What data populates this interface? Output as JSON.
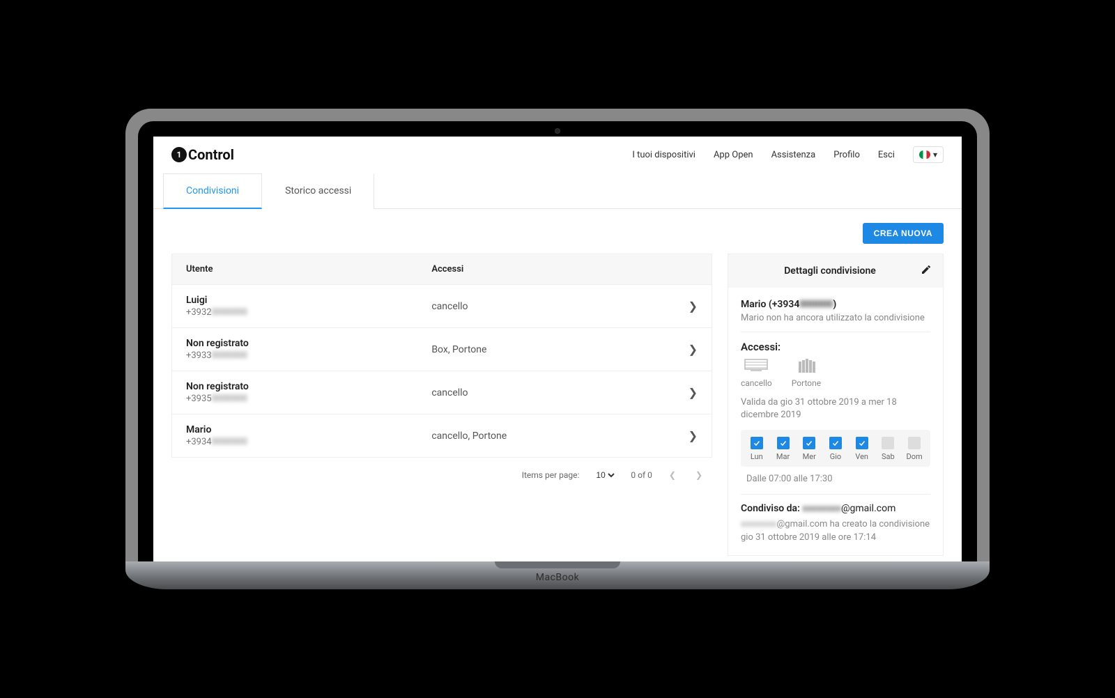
{
  "brand": "Control",
  "nav": {
    "devices": "I tuoi dispositivi",
    "appopen": "App Open",
    "assist": "Assistenza",
    "profile": "Profilo",
    "logout": "Esci"
  },
  "tabs": {
    "shares": "Condivisioni",
    "history": "Storico accessi"
  },
  "toolbar": {
    "create": "CREA NUOVA"
  },
  "table": {
    "head_user": "Utente",
    "head_access": "Accessi",
    "rows": [
      {
        "name": "Luigi",
        "phone_prefix": "+3932",
        "phone_hidden": "0000000",
        "access": "cancello"
      },
      {
        "name": "Non registrato",
        "phone_prefix": "+3933",
        "phone_hidden": "0000000",
        "access": "Box, Portone"
      },
      {
        "name": "Non registrato",
        "phone_prefix": "+3935",
        "phone_hidden": "0000000",
        "access": "cancello"
      },
      {
        "name": "Mario",
        "phone_prefix": "+3934",
        "phone_hidden": "0000000",
        "access": "cancello, Portone"
      }
    ]
  },
  "paginator": {
    "label": "Items per page:",
    "size": "10",
    "range": "0 of 0"
  },
  "details": {
    "title": "Dettagli condivisione",
    "name_prefix": "Mario (+3934",
    "name_hidden": "000000",
    "name_suffix": ")",
    "note": "Mario non ha ancora utilizzato la condivisione",
    "accessi_label": "Accessi:",
    "accesses": [
      {
        "label": "cancello"
      },
      {
        "label": "Portone"
      }
    ],
    "validity": "Valida da gio 31 ottobre 2019 a mer 18 dicembre 2019",
    "days": [
      {
        "label": "Lun",
        "on": true
      },
      {
        "label": "Mar",
        "on": true
      },
      {
        "label": "Mer",
        "on": true
      },
      {
        "label": "Gio",
        "on": true
      },
      {
        "label": "Ven",
        "on": true
      },
      {
        "label": "Sab",
        "on": false
      },
      {
        "label": "Dom",
        "on": false
      }
    ],
    "hours": "Dalle 07:00 alle 17:30",
    "shared_label": "Condiviso da: ",
    "shared_email_hidden": "xxxxxxxx",
    "shared_email_suffix": "@gmail.com",
    "shared_note_hidden": "xxxxxxxx",
    "shared_note_text": "@gmail.com ha creato la condivisione gio 31 ottobre 2019 alle ore 17:14"
  },
  "laptop_brand": "MacBook"
}
